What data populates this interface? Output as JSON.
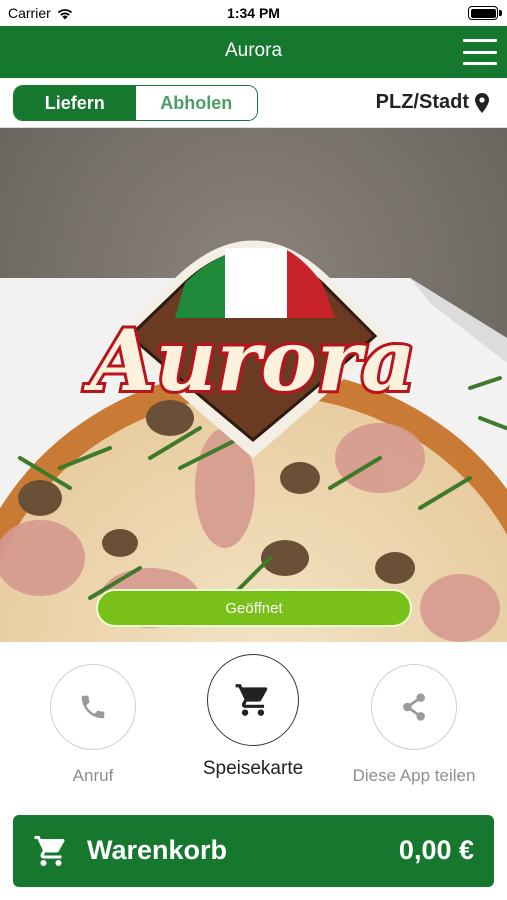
{
  "status_bar": {
    "carrier": "Carrier",
    "time": "1:34 PM"
  },
  "header": {
    "title": "Aurora"
  },
  "mode": {
    "deliver_label": "Liefern",
    "pickup_label": "Abholen",
    "location_label": "PLZ/Stadt"
  },
  "hero": {
    "logo_text": "Aurora",
    "status_label": "Geöffnet"
  },
  "actions": [
    {
      "label": "Anruf",
      "icon": "phone-icon"
    },
    {
      "label": "Speisekarte",
      "icon": "cart-icon"
    },
    {
      "label": "Diese App teilen",
      "icon": "share-icon"
    }
  ],
  "cart": {
    "label": "Warenkorb",
    "total": "0,00 €"
  },
  "colors": {
    "brand_green": "#16772f",
    "open_green": "#79c11a"
  }
}
